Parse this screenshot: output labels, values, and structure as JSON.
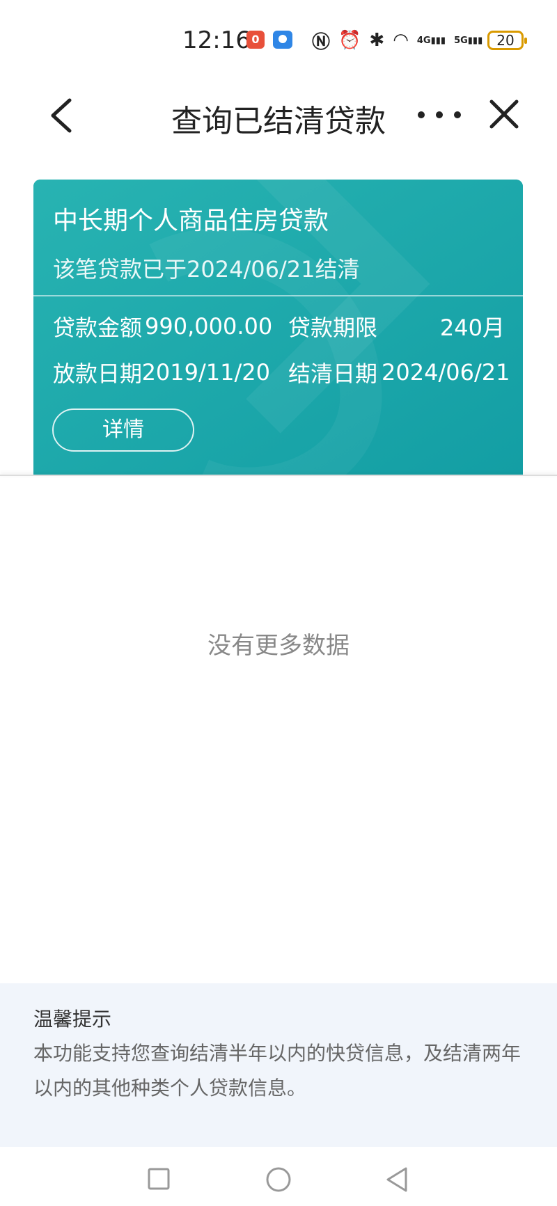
{
  "status_bar": {
    "time": "12:16",
    "notification_badge": "0",
    "icons": [
      "nfc-icon",
      "alarm-icon",
      "bluetooth-icon",
      "wifi-icon",
      "signal-4g-icon",
      "signal-5g-icon"
    ],
    "signal_4g_label": "4G",
    "signal_5g_label": "5G",
    "battery": "20"
  },
  "header": {
    "title": "查询已结清贷款"
  },
  "loan_card": {
    "loan_type": "中长期个人商品住房贷款",
    "settle_message": "该笔贷款已于2024/06/21结清",
    "amount_label": "贷款金额",
    "amount_value": "990,000.00",
    "term_label": "贷款期限",
    "term_value": "240月",
    "disburse_label": "放款日期",
    "disburse_value": "2019/11/20",
    "settle_label": "结清日期",
    "settle_value": "2024/06/21",
    "detail_button": "详情"
  },
  "list_footer": "没有更多数据",
  "tips": {
    "title": "温馨提示",
    "body": "本功能支持您查询结清半年以内的快贷信息，及结清两年以内的其他种类个人贷款信息。"
  },
  "colors": {
    "card_bg": "#1fa8aa",
    "battery_accent": "#d99a00",
    "tips_bg": "#f1f5fb"
  }
}
